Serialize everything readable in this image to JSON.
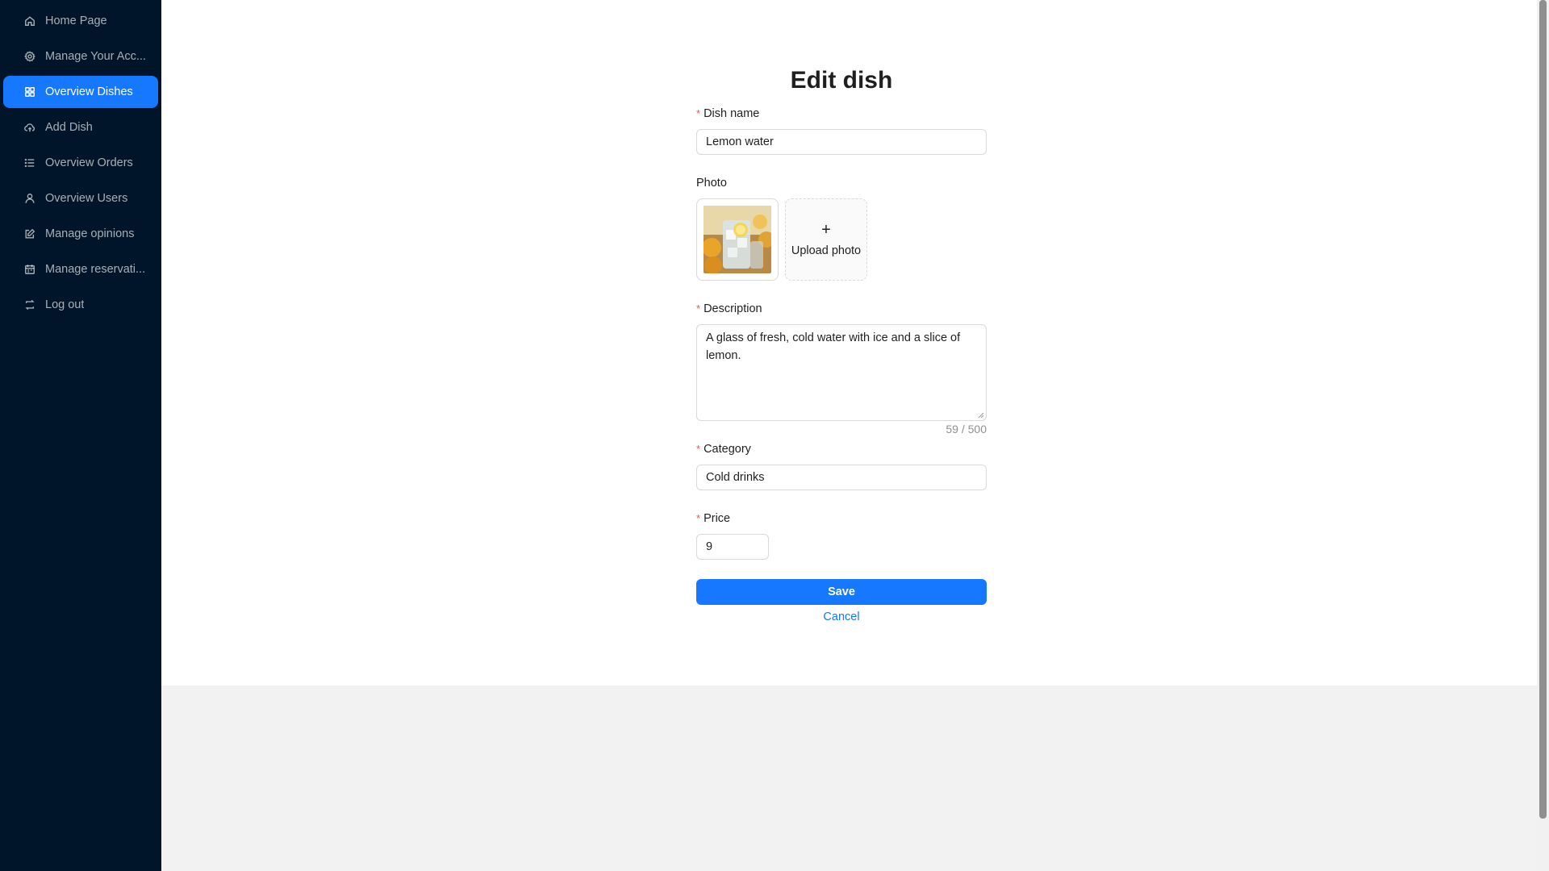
{
  "sidebar": {
    "items": [
      {
        "label": "Home Page",
        "icon": "home-icon"
      },
      {
        "label": "Manage Your Acc...",
        "icon": "gear-icon"
      },
      {
        "label": "Overview Dishes",
        "icon": "grid-icon",
        "active": true
      },
      {
        "label": "Add Dish",
        "icon": "cloud-upload-icon"
      },
      {
        "label": "Overview Orders",
        "icon": "list-icon"
      },
      {
        "label": "Overview Users",
        "icon": "user-icon"
      },
      {
        "label": "Manage opinions",
        "icon": "edit-icon"
      },
      {
        "label": "Manage reservati...",
        "icon": "calendar-icon"
      },
      {
        "label": "Log out",
        "icon": "logout-icon"
      }
    ]
  },
  "form": {
    "title": "Edit dish",
    "dish_name": {
      "label": "Dish name",
      "value": "Lemon water"
    },
    "photo": {
      "label": "Photo",
      "upload_label": "Upload photo",
      "upload_icon": "plus-icon"
    },
    "description": {
      "label": "Description",
      "value": "A glass of fresh, cold water with ice and a slice of lemon.",
      "counter": "59 / 500"
    },
    "category": {
      "label": "Category",
      "value": "Cold drinks"
    },
    "price": {
      "label": "Price",
      "value": "9"
    },
    "save_label": "Save",
    "cancel_label": "Cancel"
  },
  "colors": {
    "sidebar_bg": "#001529",
    "accent": "#1677ff",
    "required": "#ff4d4f"
  }
}
